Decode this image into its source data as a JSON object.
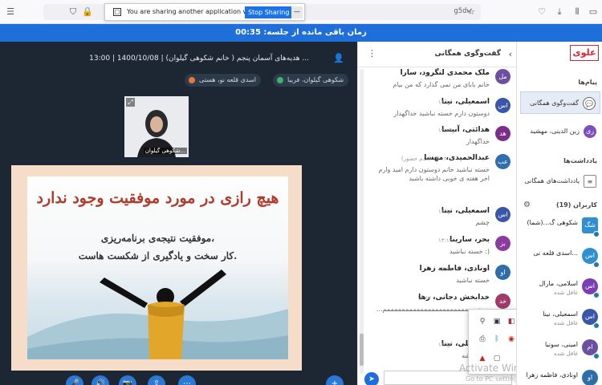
{
  "browser": {
    "url_fragment": "g5dw",
    "share_banner": {
      "message": "You are sharing another application window.",
      "stop_label": "Stop Sharing",
      "minimize_label": "—"
    }
  },
  "timer": {
    "text": "زمان باقی مانده از جلسه: 00:35"
  },
  "session": {
    "title": "هدیه‌های آسمان پنجم ( خانم شکوهی گیلوان) | 1400/10/08 | 13:00 ...",
    "chips": [
      {
        "label": "شکوهی گیلوان، فریبا",
        "color": "#3cb371"
      },
      {
        "label": "اسدی قلعه نو، هستی",
        "color": "#e07b39"
      }
    ],
    "webcam_label": "شکوهی گیلوان..."
  },
  "slide": {
    "headline": "هیچ رازی در مورد موفقیت وجود ندارد",
    "line1": "موفقیت نتیجه‌ی برنامه‌ریزی،",
    "line2": "کار سخت و یادگیری از شکست هاست."
  },
  "chat": {
    "title": "گفت‌وگوی همگانی",
    "messages": [
      {
        "initials": "مل",
        "name": "ملک محمدی لنگرود، سارا",
        "time": "",
        "text": "خانم بابای من نمی گذارد که من بیام",
        "color": "#6b4fa0"
      },
      {
        "initials": "اس",
        "name": "اسمعیلی، نینا",
        "time": "۱۳:۱۲",
        "text": "دوستون دارم خسته نباشید خداگهدار",
        "color": "#3a56a8"
      },
      {
        "initials": "هد",
        "name": "هدائتی، آنیسا",
        "time": "۱۳:۱۲",
        "text": "خداگهدار",
        "color": "#7a2e8a"
      },
      {
        "initials": "عب",
        "name": "عبدالحمیدی، مهسا",
        "time": "(عدم حضور) ۱۳:۱۲",
        "text": "خسته نباشید خانم دوستون دارم امید وارم اخر هفته ی خوبی داشته باشید",
        "color": "#2f6fb0"
      },
      {
        "initials": "اس",
        "name": "اسمعیلی، نینا",
        "time": "۱۳:۱۲",
        "text": "چشم",
        "color": "#3a56a8"
      },
      {
        "initials": "بز",
        "name": "بحر، سارینا",
        "time": "۱۳:۱۲",
        "text": "خسته نباشید :)",
        "color": "#8a3b9e"
      },
      {
        "initials": "او",
        "name": "اونادی، فاطمه زهرا",
        "time": "۱۳:۱۲",
        "text": "خسته نباشید",
        "color": "#2e6ea8"
      },
      {
        "initials": "خد",
        "name": "خدابخش دجانی، رها",
        "time": "۱۳:۱۲",
        "text": "...جون ممممممممممممممممممممممممم",
        "color": "#a03a6a"
      },
      {
        "initials": "اس",
        "name": "اسمعیلی، نینا",
        "time": "۱۳:۱۳",
        "text": "ببنگ میشه",
        "color": "#3a56a8"
      }
    ]
  },
  "tray": {
    "icons": [
      "usb-icon",
      "display-icon",
      "app-icon",
      "printer-icon",
      "bluetooth-icon",
      "record-icon",
      "security-icon",
      "window-icon"
    ]
  },
  "watermark": {
    "title": "Activate Windows",
    "subtitle": "Go to PC settings to activate"
  },
  "sidebar": {
    "logo": "علوی",
    "messages_title": "پیام‌ها",
    "items": [
      {
        "label": "گفت‌وگوی همگانی",
        "icon": "chat-icon",
        "active": true
      },
      {
        "label": "زین الدینی، مهشید",
        "initials": "زی",
        "color": "#7a4fc0"
      }
    ],
    "notes_title": "یادداشت‌ها",
    "notes_item": "یادداشت‌های همگانی",
    "users_title": "کاربران (19)",
    "users": [
      {
        "initials": "شگ",
        "name": "شکوهی گ...(شما)",
        "status": "",
        "color": "#2f8fd0"
      },
      {
        "initials": "اس",
        "name": "اسدی قلعه نی...",
        "status": "",
        "color": "#2f8fd0"
      },
      {
        "initials": "اس",
        "name": "اسلامی، مارال",
        "status": "غافل شده",
        "color": "#7a3fb0"
      },
      {
        "initials": "اس",
        "name": "اسمعیلی، نینا",
        "status": "غافل شده",
        "color": "#3a56a8"
      },
      {
        "initials": "ام",
        "name": "امینی، سونیا",
        "status": "غافل شده",
        "color": "#6b4fa0"
      },
      {
        "initials": "او",
        "name": "اونادی، فاطمه زهرا",
        "status": "",
        "color": "#2e6ea8"
      }
    ]
  }
}
